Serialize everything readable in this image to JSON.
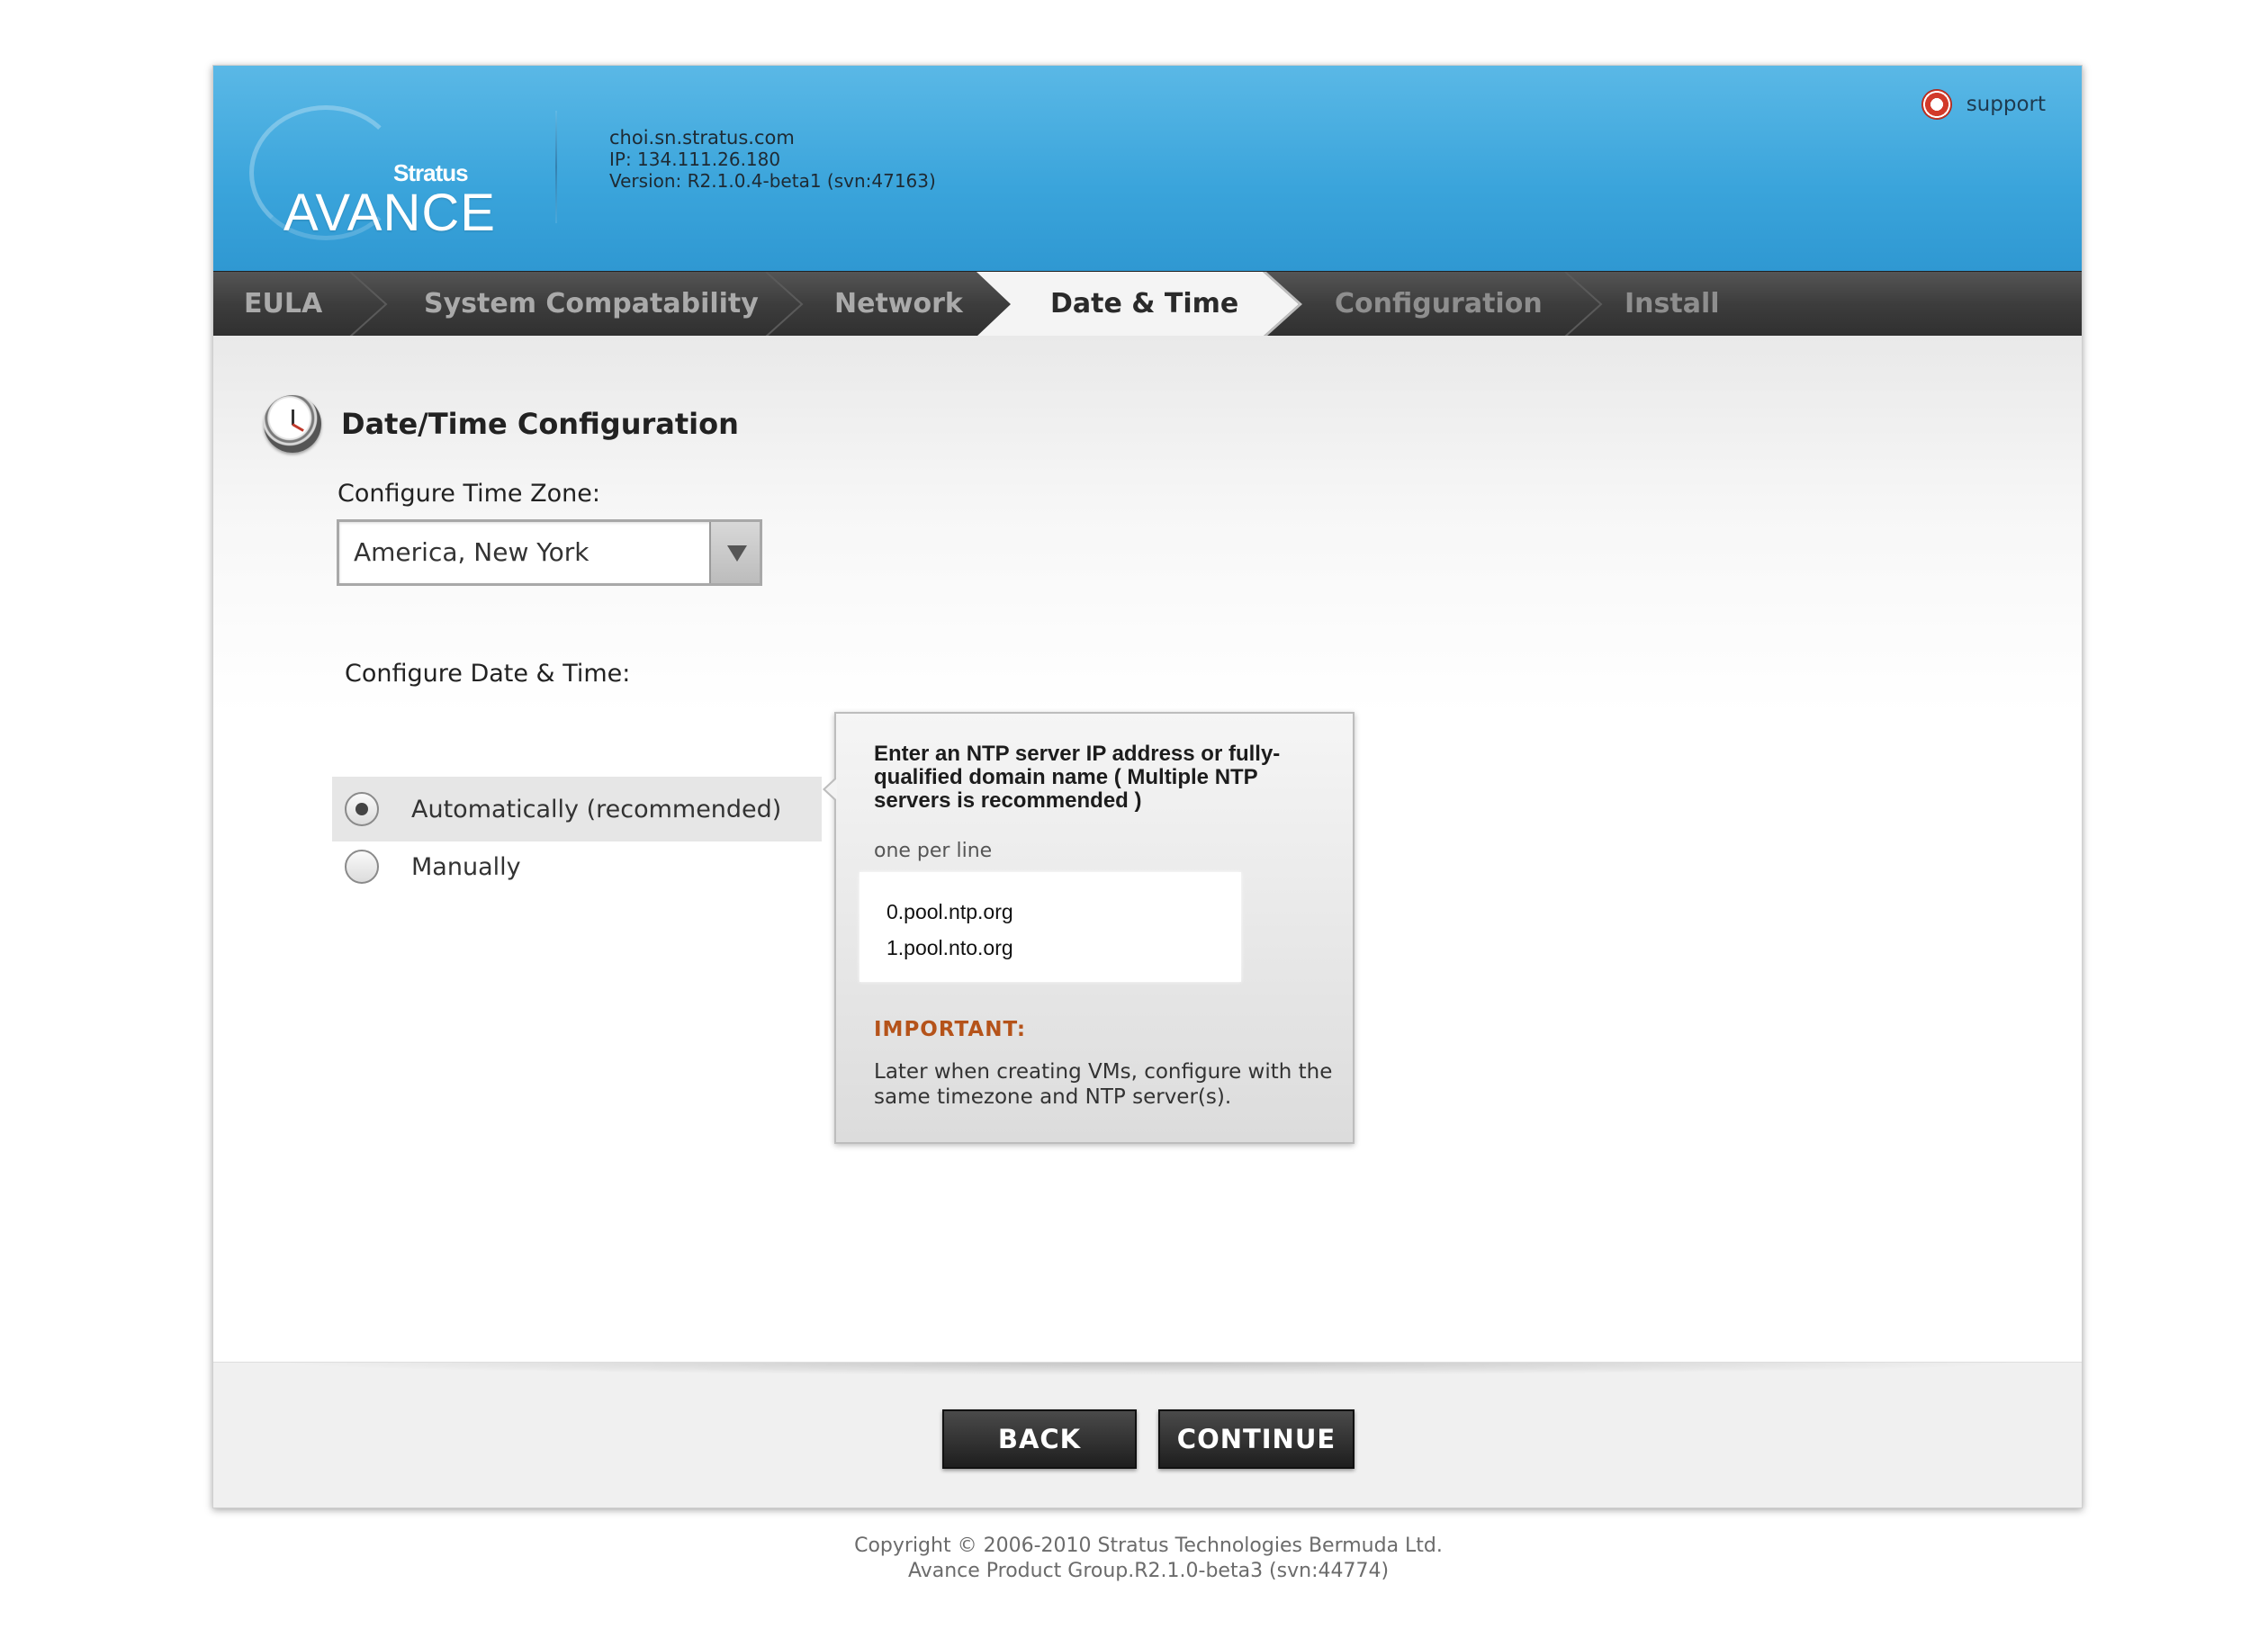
{
  "header": {
    "brand_small": "Stratus",
    "brand_large": "AVANCE",
    "host": "choi.sn.stratus.com",
    "ip": "IP: 134.111.26.180",
    "version": "Version: R2.1.0.4-beta1 (svn:47163)",
    "support_label": "support",
    "support_icon": "lifebuoy-icon"
  },
  "wizard": {
    "steps": [
      {
        "label": "EULA",
        "state": "done"
      },
      {
        "label": "System Compatability",
        "state": "done"
      },
      {
        "label": "Network",
        "state": "done"
      },
      {
        "label": "Date & Time",
        "state": "active"
      },
      {
        "label": "Configuration",
        "state": "future"
      },
      {
        "label": "Install",
        "state": "future"
      }
    ]
  },
  "content": {
    "title": "Date/Time Configuration",
    "title_icon": "clock-icon",
    "timezone": {
      "label": "Configure Time Zone:",
      "value": "America, New York"
    },
    "datetime": {
      "label": "Configure Date & Time:",
      "options": [
        {
          "label": "Automatically (recommended)",
          "selected": true
        },
        {
          "label": "Manually",
          "selected": false
        }
      ]
    },
    "ntp": {
      "instructions": "Enter an NTP server IP address or fully-qualified domain name ( Multiple NTP servers is recommended )",
      "hint": "one per line",
      "servers": [
        "0.pool.ntp.org",
        "1.pool.nto.org"
      ],
      "important_label": "IMPORTANT:",
      "important_note": "Later when creating VMs, configure with the same timezone and NTP server(s)."
    }
  },
  "buttons": {
    "back": "BACK",
    "continue": "CONTINUE"
  },
  "footer": {
    "copyright": "Copyright © 2006-2010 Stratus Technologies Bermuda Ltd.",
    "product": "Avance Product Group.R2.1.0-beta3 (svn:44774)"
  },
  "colors": {
    "header_blue": "#3aa4db",
    "tab_bar": "#3d3d3d",
    "important": "#b5531a",
    "button_dark": "#2a2a2a"
  }
}
